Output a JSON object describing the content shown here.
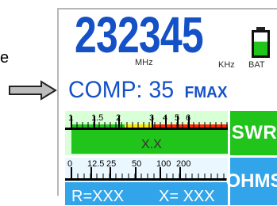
{
  "annotation": {
    "side_letter": "e"
  },
  "display": {
    "frequency_digits": "232345",
    "unit_mhz": "MHz",
    "unit_khz": "KHz",
    "unit_bat": "BAT",
    "battery_level": 0.6,
    "comp_label": "COMP:",
    "comp_value": "35",
    "fmax": "FMAX"
  },
  "swr": {
    "button_label": "SWR",
    "ticks": [
      "1",
      "1.5",
      "2",
      "3",
      "4",
      "5",
      "6"
    ],
    "value": "X.X"
  },
  "ohms": {
    "button_label": "OHMS",
    "ticks": [
      "0",
      "12.5",
      "25",
      "50",
      "100",
      "200"
    ],
    "r_value": "R=XXX",
    "x_value": "X=  XXX"
  },
  "colors": {
    "accent": "#1451c7",
    "swr_button": "#20c41a",
    "ohms_button": "#32a5ea",
    "bar_green": "#20c41a",
    "bar_yellow": "#ffe600",
    "bar_red": "#ff2a00"
  }
}
